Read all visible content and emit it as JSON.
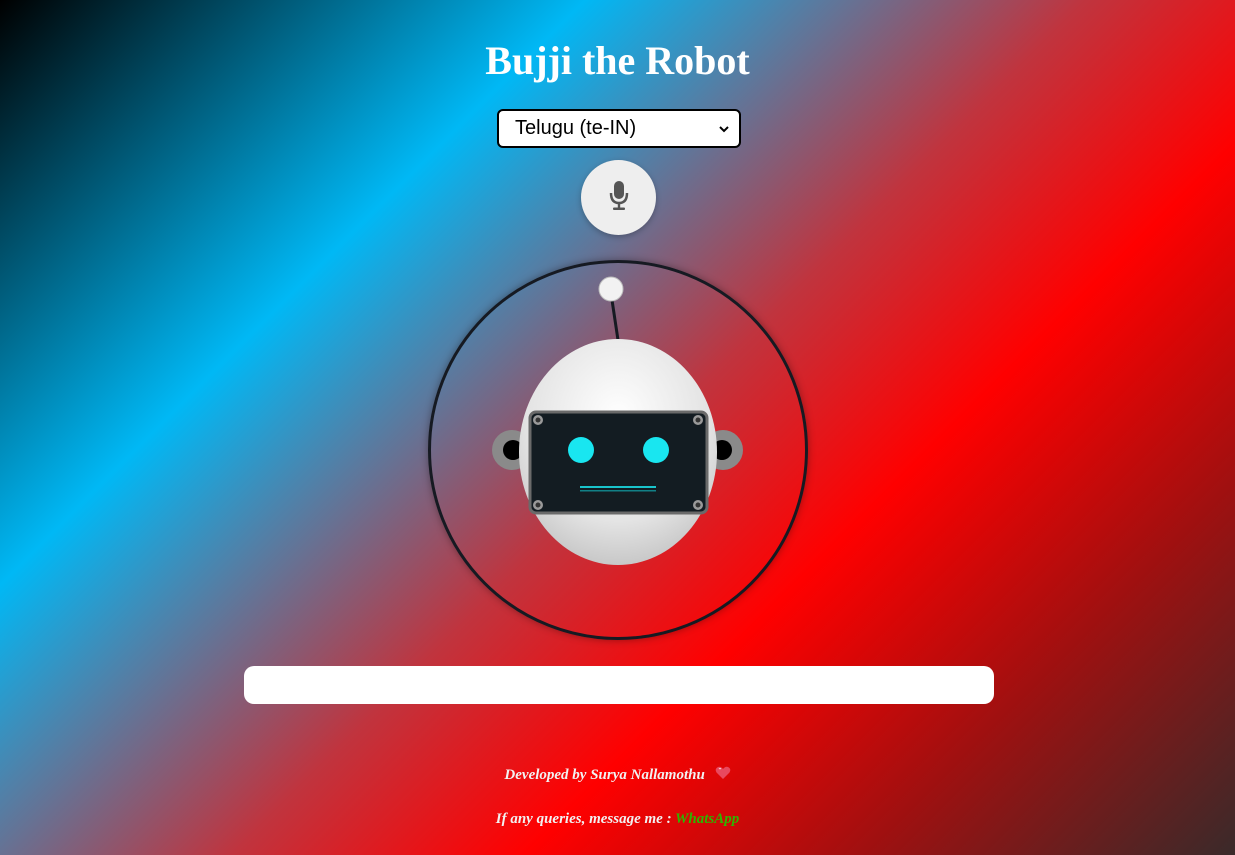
{
  "header": {
    "title": "Bujji the Robot"
  },
  "language_select": {
    "selected": "Telugu (te-IN)",
    "icon": "chevron-down-icon"
  },
  "mic_button": {
    "icon": "microphone-icon"
  },
  "robot": {
    "icon": "robot-face-illustration",
    "colors": {
      "eyes": "#19e6f0",
      "visor": "#131c22",
      "head": "#e9e9e9",
      "ring": "#161a22"
    }
  },
  "output": {
    "text": ""
  },
  "footer": {
    "developed_by": "Developed by Surya Nallamothu",
    "heart_icon": "heart-icon",
    "queries_text": "If any queries, message me :",
    "whatsapp_label": "WhatsApp",
    "whatsapp_color": "#2fb400"
  }
}
